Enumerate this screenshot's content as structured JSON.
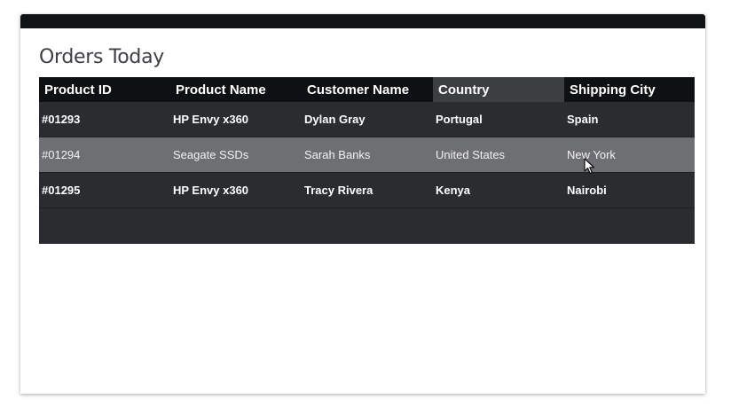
{
  "card": {
    "title": "Orders Today"
  },
  "table": {
    "headers": [
      "Product ID",
      "Product Name",
      "Customer Name",
      "Country",
      "Shipping City"
    ],
    "rows": [
      [
        "#01293",
        "HP Envy x360",
        "Dylan Gray",
        "Portugal",
        "Spain"
      ],
      [
        "#01294",
        "Seagate SSDs",
        "Sarah Banks",
        "United States",
        "New York"
      ],
      [
        "#01295",
        "HP Envy x360",
        "Tracy Rivera",
        "Kenya",
        "Nairobi"
      ]
    ]
  },
  "colors": {
    "header_bg": "#0f1012",
    "header_active_bg": "#3d3e41",
    "row_bg": "#2a2c30",
    "row_hover_bg": "#6e6f72",
    "title_text": "#3c3f44"
  },
  "icons": {
    "pointer": "mouse-pointer-icon"
  }
}
